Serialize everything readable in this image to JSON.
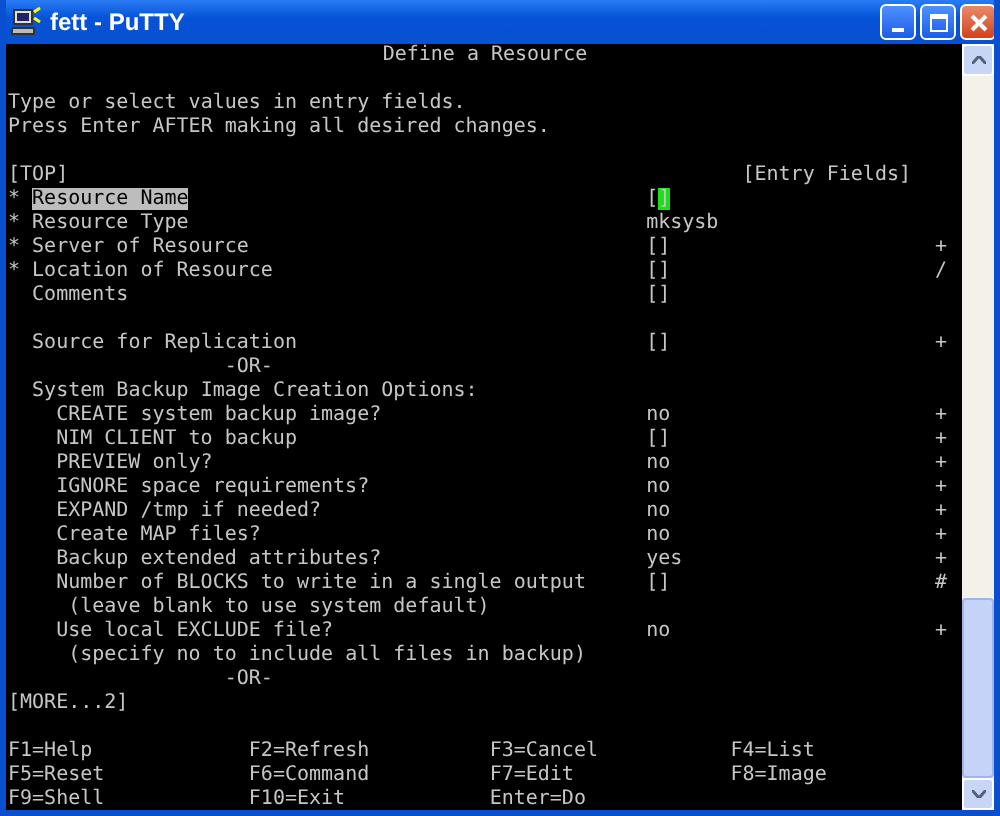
{
  "window": {
    "title": "fett - PuTTY"
  },
  "screen": {
    "title": "Define a Resource",
    "instructions": [
      "Type or select values in entry fields.",
      "Press Enter AFTER making all desired changes."
    ],
    "top_marker": "[TOP]",
    "column_header": "[Entry Fields]",
    "rows": [
      {
        "kind": "field",
        "mark": "*",
        "label": "Resource Name",
        "value": "[]",
        "highlighted": true,
        "cursor": true
      },
      {
        "kind": "field",
        "mark": "*",
        "label": "Resource Type",
        "value": "mksysb",
        "highlighted": false,
        "cursor": false
      },
      {
        "kind": "field",
        "mark": "*",
        "label": "Server of Resource",
        "value": "[]",
        "hint": "+",
        "highlighted": false,
        "cursor": false
      },
      {
        "kind": "field",
        "mark": "*",
        "label": "Location of Resource",
        "value": "[]",
        "hint": "/",
        "highlighted": false,
        "cursor": false
      },
      {
        "kind": "field",
        "label": "Comments",
        "value": "[]",
        "highlighted": false,
        "cursor": false
      },
      {
        "kind": "blank"
      },
      {
        "kind": "field",
        "label": "Source for Replication",
        "value": "[]",
        "hint": "+",
        "highlighted": false,
        "cursor": false
      },
      {
        "kind": "separator",
        "text": "-OR-"
      },
      {
        "kind": "group",
        "label": "System Backup Image Creation Options:",
        "children": [
          {
            "label": "CREATE system backup image?",
            "value": "no",
            "hint": "+",
            "highlighted": false,
            "cursor": false
          },
          {
            "label": "NIM CLIENT to backup",
            "value": "[]",
            "hint": "+",
            "highlighted": false,
            "cursor": false
          },
          {
            "label": "PREVIEW only?",
            "value": "no",
            "hint": "+",
            "highlighted": false,
            "cursor": false
          },
          {
            "label": "IGNORE space requirements?",
            "value": "no",
            "hint": "+",
            "highlighted": false,
            "cursor": false
          },
          {
            "label": "EXPAND /tmp if needed?",
            "value": "no",
            "hint": "+",
            "highlighted": false,
            "cursor": false
          },
          {
            "label": "Create MAP files?",
            "value": "no",
            "hint": "+",
            "highlighted": false,
            "cursor": false
          },
          {
            "label": "Backup extended attributes?",
            "value": "yes",
            "hint": "+",
            "highlighted": false,
            "cursor": false
          },
          {
            "label": "Number of BLOCKS to write in a single output",
            "value": "[]",
            "hint": "#",
            "note": "(leave blank to use system default)",
            "highlighted": false,
            "cursor": false
          },
          {
            "label": "Use local EXCLUDE file?",
            "value": "no",
            "hint": "+",
            "note": "(specify no to include all files in backup)",
            "highlighted": false,
            "cursor": false
          }
        ]
      },
      {
        "kind": "separator",
        "text": "-OR-"
      }
    ],
    "more": "[MORE...2]",
    "function_keys": [
      "F1=Help",
      "F2=Refresh",
      "F3=Cancel",
      "F4=List",
      "F5=Reset",
      "F6=Command",
      "F7=Edit",
      "F8=Image",
      "F9=Shell",
      "F10=Exit",
      "Enter=Do"
    ]
  }
}
